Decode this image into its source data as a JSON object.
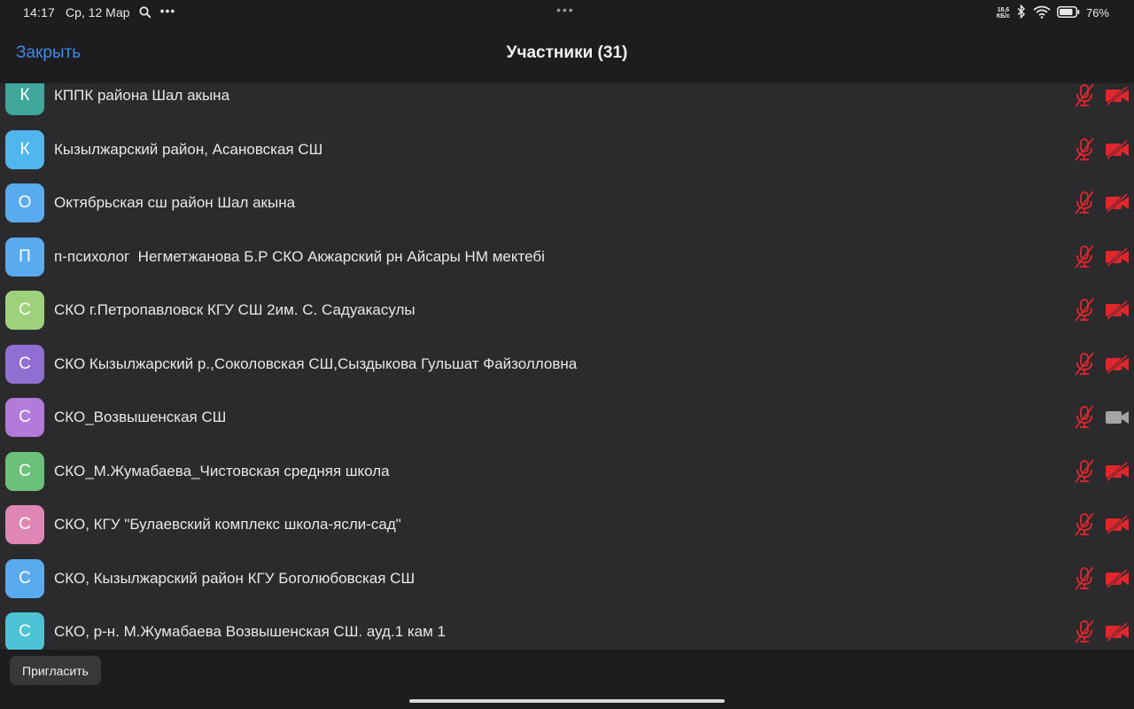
{
  "status_bar": {
    "time": "14:17",
    "date": "Ср, 12 Мар",
    "overflow": "•••",
    "center_dots": "•••",
    "net_speed_value": "18,6",
    "net_speed_unit": "КБ/с",
    "battery": "76%",
    "icons": [
      "search-icon",
      "bluetooth-icon",
      "wifi-icon",
      "battery-icon"
    ]
  },
  "header": {
    "close_label": "Закрыть",
    "title": "Участники (31)"
  },
  "colors": {
    "accent": "#3f8ae8",
    "muted_red": "#e2262e",
    "cam_on_gray": "#a5a5a5"
  },
  "participants": [
    {
      "initial": "К",
      "name": "КППК района Шал акына",
      "avatar_color": "#3fa89a",
      "mic": "muted",
      "video": "off"
    },
    {
      "initial": "К",
      "name": "Кызылжарский район, Асановская СШ",
      "avatar_color": "#4fb7ee",
      "mic": "muted",
      "video": "off"
    },
    {
      "initial": "О",
      "name": "Октябрьская сш район Шал акына",
      "avatar_color": "#5aaaf0",
      "mic": "muted",
      "video": "off"
    },
    {
      "initial": "П",
      "name": "п-психолог  Негметжанова Б.Р СКО Акжарский рн Айсары НМ мектебі",
      "avatar_color": "#5aaaf0",
      "mic": "muted",
      "video": "off"
    },
    {
      "initial": "С",
      "name": "СКО г.Петропавловск КГУ СШ 2им. С. Садуакасулы",
      "avatar_color": "#9dd17a",
      "mic": "muted",
      "video": "off"
    },
    {
      "initial": "С",
      "name": "СКО Кызылжарский р.,Соколовская СШ,Сыздыкова Гульшат Файзолловна",
      "avatar_color": "#8f6fd1",
      "mic": "muted",
      "video": "off"
    },
    {
      "initial": "С",
      "name": "СКО_Возвышенская СШ",
      "avatar_color": "#b27ad9",
      "mic": "muted",
      "video": "on"
    },
    {
      "initial": "С",
      "name": "СКО_М.Жумабаева_Чистовская средняя школа",
      "avatar_color": "#6cc17a",
      "mic": "muted",
      "video": "off"
    },
    {
      "initial": "С",
      "name": "СКО, КГУ \"Булаевский комплекс школа-ясли-сад\"",
      "avatar_color": "#e086b4",
      "mic": "muted",
      "video": "off"
    },
    {
      "initial": "С",
      "name": "СКО, Кызылжарский район КГУ Боголюбовская СШ",
      "avatar_color": "#5aaaf0",
      "mic": "muted",
      "video": "off"
    },
    {
      "initial": "С",
      "name": "СКО, р-н. М.Жумабаева Возвышенская СШ. ауд.1 кам 1",
      "avatar_color": "#4cc3d6",
      "mic": "muted",
      "video": "off"
    }
  ],
  "footer": {
    "invite_label": "Пригласить"
  }
}
